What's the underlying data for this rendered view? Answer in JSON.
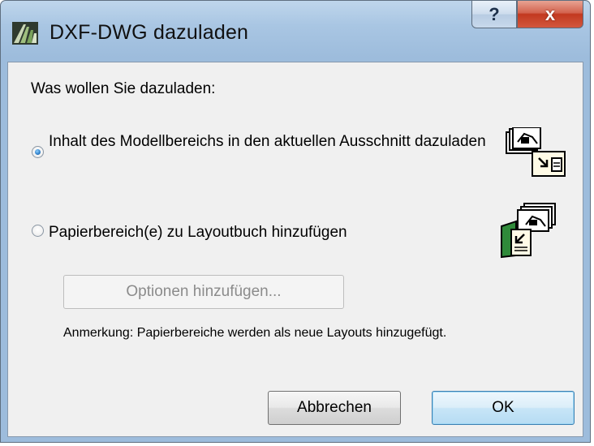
{
  "window": {
    "title": "DXF-DWG dazuladen",
    "help_label": "?",
    "close_label": "x"
  },
  "dialog": {
    "prompt": "Was wollen Sie dazuladen:",
    "option_model": {
      "label": "Inhalt des Modellbereichs in den aktuellen Ausschnitt dazuladen",
      "selected": true
    },
    "option_paper": {
      "label": "Papierbereich(e) zu Layoutbuch hinzufügen",
      "selected": false
    },
    "options_button": "Optionen hinzufügen...",
    "options_button_enabled": false,
    "note": "Anmerkung: Papierbereiche werden als neue Layouts hinzugefügt.",
    "cancel_button": "Abbrechen",
    "ok_button": "OK"
  },
  "icons": {
    "title": "archicad-logo-icon",
    "option_model": "model-space-import-icon",
    "option_paper": "paper-space-layout-icon"
  },
  "colors": {
    "titlebar": "#a9c6e3",
    "close_button": "#c2381f",
    "client_bg": "#f0f0f0",
    "default_button_border": "#3c7fb1",
    "disabled_text": "#8b8b8b"
  }
}
